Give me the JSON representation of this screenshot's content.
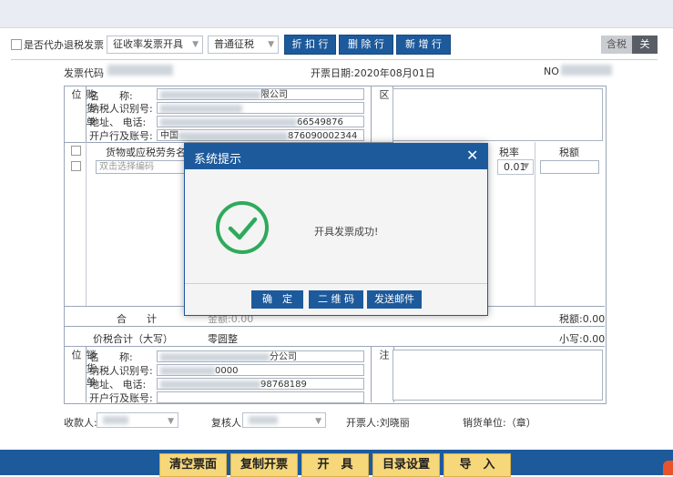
{
  "toolbar": {
    "agent_refund_checkbox_label": "是否代办退税发票",
    "tax_mode_select": "征收率发票开具",
    "tax_type_select": "普通征税",
    "discount_row_btn": "折 扣 行",
    "delete_row_btn": "删 除 行",
    "add_row_btn": "新 增 行",
    "tax_incl_toggle": "含税",
    "tax_incl_state": "关"
  },
  "invoice": {
    "code_label": "发票代码",
    "date_label": "开票日期:2020年08月01日",
    "no_label": "NO",
    "buyer_side": "购货单位",
    "buyer": {
      "name_label": "名　　称:",
      "name_value_suffix": "限公司",
      "taxid_label": "纳税人识别号:",
      "addr_label": "地址、 电话:",
      "addr_value_suffix": "66549876",
      "bank_label": "开户行及账号:",
      "bank_value_prefix": "中国",
      "bank_value_suffix": "876090002344"
    },
    "password_area": "密码区",
    "goods_header": "货物或应税劳务名称",
    "goods_placeholder": "双击选择编码",
    "rate_header": "税率",
    "rate_value": "0.01",
    "tax_header": "税额",
    "total_label": "合　　计",
    "amount_total": "金额:0.00",
    "tax_total": "税额:0.00",
    "price_tax_label": "价税合计（大写）",
    "price_tax_upper": "零圆整",
    "price_tax_lower": "小写:0.00",
    "seller_side": "销货单位",
    "seller": {
      "name_label": "名　　称:",
      "name_value_suffix": "分公司",
      "taxid_label": "纳税人识别号:",
      "taxid_value_suffix": "0000",
      "addr_label": "地址、 电话:",
      "addr_value_suffix": "98768189",
      "bank_label": "开户行及账号:"
    },
    "remark_area": "备注",
    "payee_label": "收款人:",
    "reviewer_label": "复核人:",
    "issuer_label": "开票人:刘晓丽",
    "seller_seal": "销货单位:（章）"
  },
  "dialog": {
    "title": "系统提示",
    "message": "开具发票成功!",
    "confirm_btn": "确　定",
    "qrcode_btn": "二 维 码",
    "email_btn": "发送邮件"
  },
  "bottom_bar": {
    "clear_btn": "清空票面",
    "copy_btn": "复制开票",
    "issue_btn": "开　具",
    "catalog_btn": "目录设置",
    "import_btn": "导　入"
  },
  "colors": {
    "primary": "#1d5a9c",
    "success": "#2eaa5c",
    "bottom_button": "#f6d779"
  }
}
